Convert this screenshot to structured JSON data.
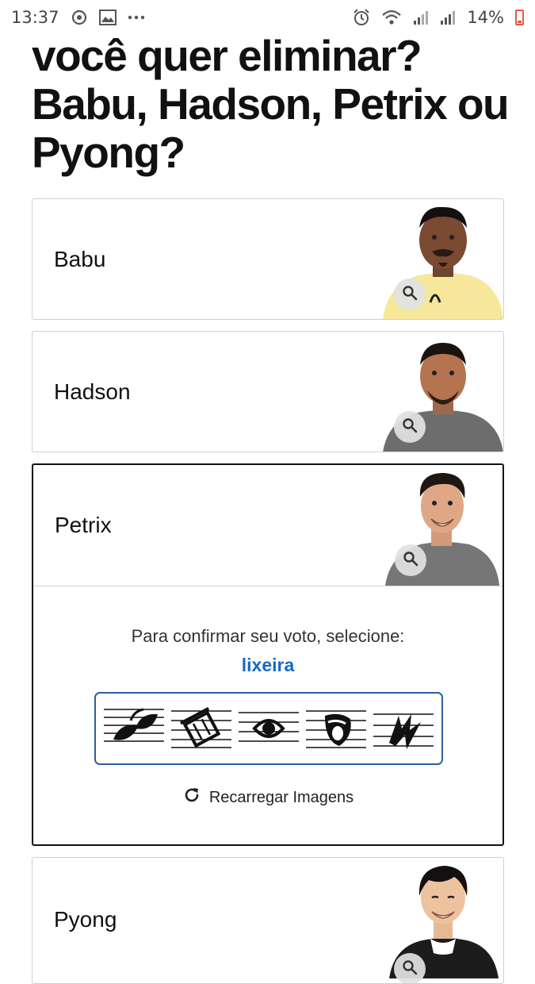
{
  "status_bar": {
    "time": "13:37",
    "battery": "14%",
    "icons": [
      "sync-icon",
      "gallery-icon",
      "more-dots-icon",
      "alarm-icon",
      "wifi-icon",
      "signal-icon",
      "signal-icon",
      "battery-icon"
    ]
  },
  "heading": "você quer eliminar? Babu, Hadson, Petrix ou Pyong?",
  "candidates": [
    {
      "name": "Babu",
      "selected": false
    },
    {
      "name": "Hadson",
      "selected": false
    },
    {
      "name": "Petrix",
      "selected": true
    },
    {
      "name": "Pyong",
      "selected": false
    }
  ],
  "captcha": {
    "instruction": "Para confirmar seu voto, selecione:",
    "target": "lixeira",
    "images": [
      "leaves-icon",
      "trash-icon",
      "eye-icon",
      "shield-icon",
      "lightning-icon"
    ],
    "reload_label": "Recarregar Imagens"
  },
  "colors": {
    "accent": "#1769c8",
    "captcha_border": "#2e5fa0",
    "selected_border": "#111111",
    "card_border": "#cfcfcf"
  }
}
